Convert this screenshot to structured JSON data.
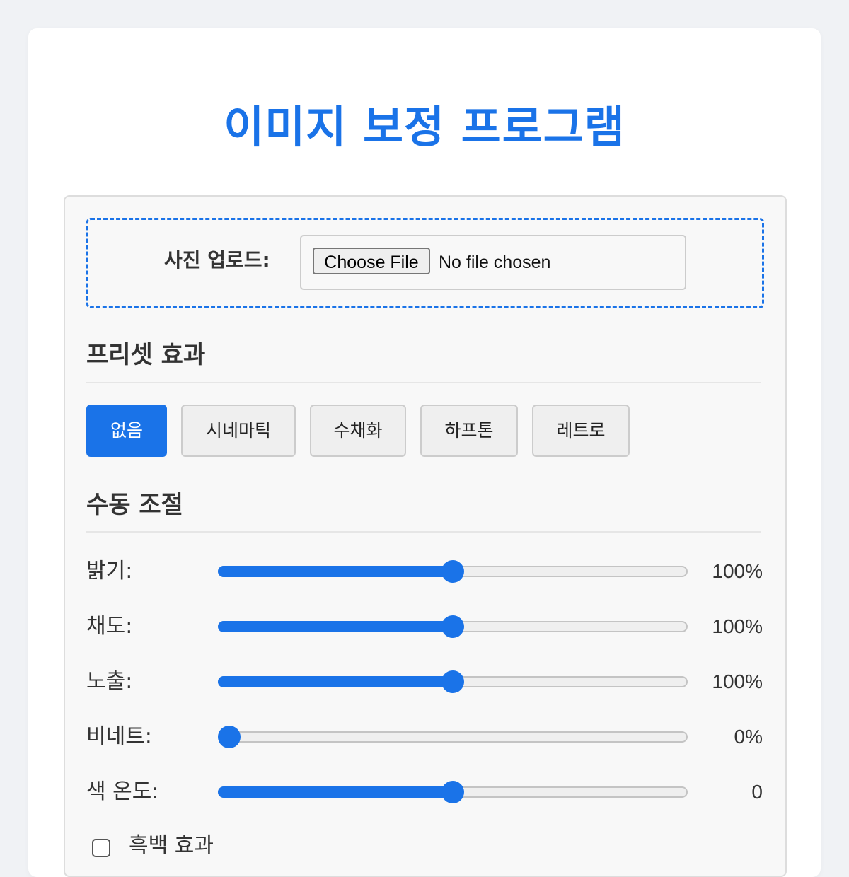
{
  "app": {
    "title": "이미지 보정 프로그램"
  },
  "upload": {
    "label": "사진 업로드:",
    "button_label": "Choose File",
    "status": "No file chosen"
  },
  "presets": {
    "title": "프리셋 효과",
    "items": [
      {
        "label": "없음",
        "active": true
      },
      {
        "label": "시네마틱",
        "active": false
      },
      {
        "label": "수채화",
        "active": false
      },
      {
        "label": "하프톤",
        "active": false
      },
      {
        "label": "레트로",
        "active": false
      }
    ]
  },
  "manual": {
    "title": "수동 조절",
    "controls": [
      {
        "label": "밝기:",
        "value_text": "100%",
        "fraction": 0.5
      },
      {
        "label": "채도:",
        "value_text": "100%",
        "fraction": 0.5
      },
      {
        "label": "노출:",
        "value_text": "100%",
        "fraction": 0.5
      },
      {
        "label": "비네트:",
        "value_text": "0%",
        "fraction": 0.0
      },
      {
        "label": "색 온도:",
        "value_text": "0",
        "fraction": 0.5
      }
    ]
  },
  "options": {
    "grayscale_label": "흑백 효과",
    "grayscale_checked": false
  },
  "colors": {
    "accent": "#1a73e8",
    "background": "#f0f2f5",
    "panel": "#f8f8f8"
  }
}
